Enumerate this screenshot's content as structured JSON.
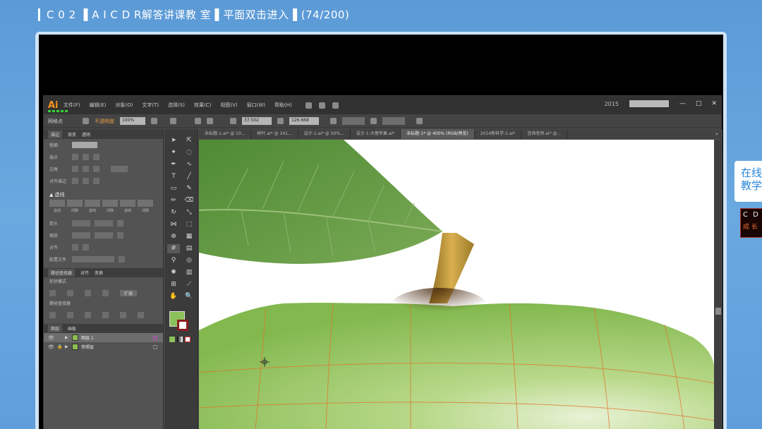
{
  "page": {
    "title": "▎C 0 2  ▐ A I  C D R解答讲课教 室 ▌平面双击进入▐ (74/200)"
  },
  "side_widget": {
    "line1": "在线",
    "line2": "教学",
    "badge_line1": "C D R",
    "badge_line2": "成 长"
  },
  "illustrator": {
    "logo": "Ai",
    "menu": [
      "文件(F)",
      "编辑(E)",
      "对象(O)",
      "文字(T)",
      "选择(S)",
      "效果(C)",
      "视图(V)",
      "窗口(W)",
      "帮助(H)"
    ],
    "year": "2015",
    "window_controls": {
      "minimize": "—",
      "maximize": "□",
      "close": "✕"
    },
    "control_bar": {
      "selection_label": "网格点",
      "style_label": "不透明度",
      "opacity_value": "100%",
      "x_value": "37.502",
      "y_value": "126.668"
    },
    "panel_tabs": [
      "描边",
      "渐变",
      "透明"
    ],
    "panel_rows": [
      {
        "label": "粗细"
      },
      {
        "label": "端点"
      },
      {
        "label": "边角"
      },
      {
        "label": "对齐描边"
      }
    ],
    "section_title": "▲ 虚线",
    "dash_labels": [
      "虚线",
      "间隙",
      "虚线",
      "间隙",
      "虚线",
      "间隙"
    ],
    "arrow_rows": [
      {
        "label": "箭头"
      },
      {
        "label": "缩放"
      },
      {
        "label": "对齐"
      }
    ],
    "profile_label": "配置文件",
    "pathfinder_tabs": [
      "路径查找器",
      "对齐",
      "变换"
    ],
    "shape_mode_label": "形状模式",
    "pathfinder_label": "路径查找器",
    "expand_label": "扩展",
    "layers_tabs": [
      "图层",
      "画板"
    ],
    "layers": [
      {
        "name": "图层 1",
        "selected": true
      },
      {
        "name": "参照层",
        "selected": false
      }
    ],
    "doc_tabs": [
      {
        "label": "未标题-1.ai* @ 10...",
        "active": false
      },
      {
        "label": "树叶.ai* @ 141...",
        "active": false
      },
      {
        "label": "设计-1.ai* @ 50%...",
        "active": false
      },
      {
        "label": "设计-1-大葱苹果.ai*",
        "active": false
      },
      {
        "label": "未标题-1* @ 400% (RGB/预览)",
        "active": true
      },
      {
        "label": "2014新科学-1.ai*",
        "active": false
      },
      {
        "label": "咨询老师.ai* @...",
        "active": false
      }
    ],
    "doc_tabs_more": "»",
    "colors": {
      "fill": "#8cc05a",
      "stroke": "#8a1c1c",
      "apple_light": "#c8e3a0",
      "apple_mid": "#8cc05a",
      "leaf": "#5f9a3e",
      "stem": "#c99a3a",
      "mesh_line": "#e0752a"
    }
  }
}
